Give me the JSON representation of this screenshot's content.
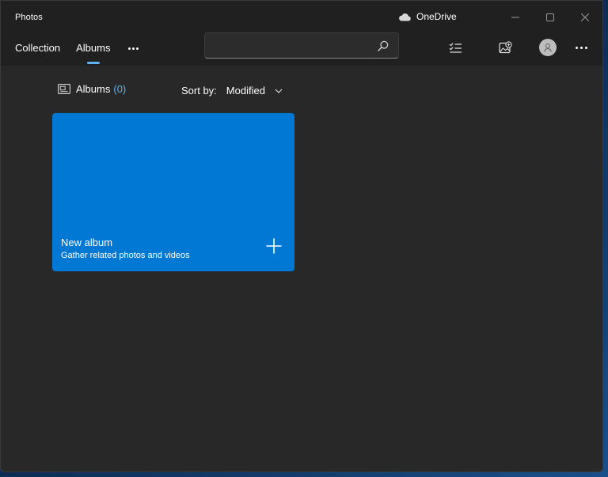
{
  "app": {
    "title": "Photos",
    "onedrive_label": "OneDrive"
  },
  "nav": {
    "tabs": [
      {
        "label": "Collection",
        "active": false
      },
      {
        "label": "Albums",
        "active": true
      }
    ]
  },
  "search": {
    "value": "",
    "placeholder": ""
  },
  "albums": {
    "heading": "Albums",
    "count": "(0)",
    "sort_label": "Sort by:",
    "sort_value": "Modified"
  },
  "new_album_card": {
    "title": "New album",
    "subtitle": "Gather related photos and videos"
  },
  "icons": {
    "onedrive": "cloud-icon",
    "minimize": "minimize-icon",
    "maximize": "maximize-icon",
    "close": "close-icon",
    "more_tabs": "more-horizontal-icon",
    "search": "search-icon",
    "select": "checklist-icon",
    "import": "import-photo-icon",
    "account": "person-icon",
    "more_app": "more-horizontal-icon",
    "albums": "album-icon",
    "sort": "chevron-down-icon",
    "add": "plus-icon"
  },
  "colors": {
    "accent": "#0078d4",
    "accent_text": "#5eb3f0",
    "window_bg": "#282828",
    "titlebar_bg": "#202020"
  }
}
